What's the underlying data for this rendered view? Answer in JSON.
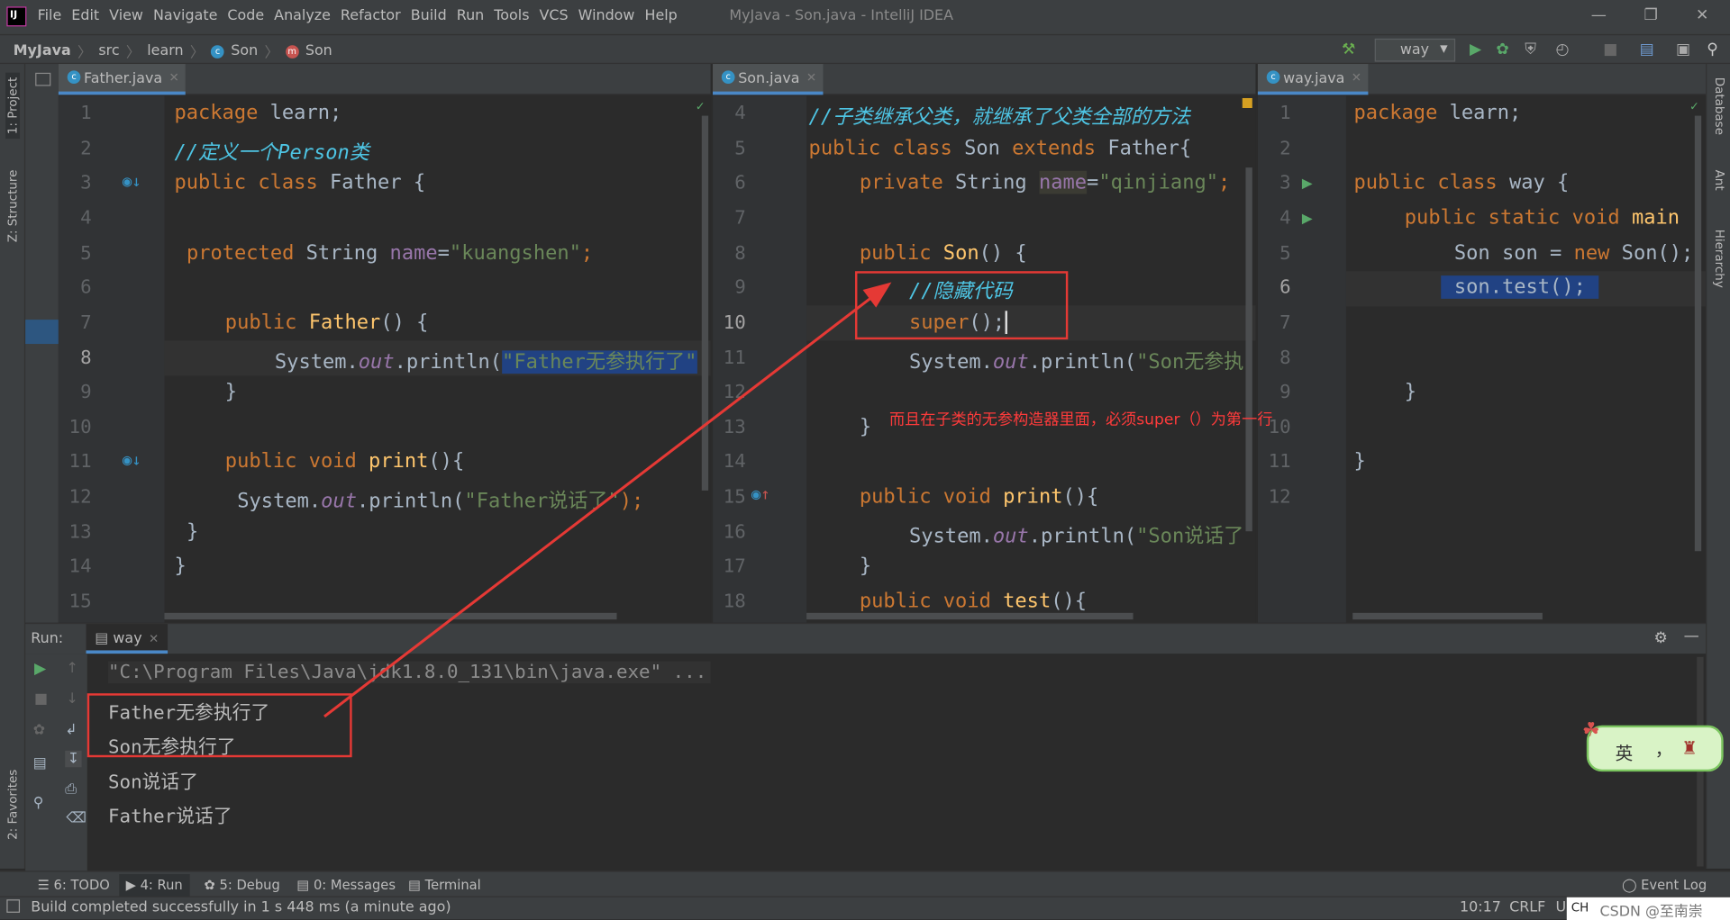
{
  "menubar": {
    "items": [
      "File",
      "Edit",
      "View",
      "Navigate",
      "Code",
      "Analyze",
      "Refactor",
      "Build",
      "Run",
      "Tools",
      "VCS",
      "Window",
      "Help"
    ],
    "title": "MyJava - Son.java - IntelliJ IDEA"
  },
  "nav": {
    "project": "MyJava",
    "src": "src",
    "pkg": "learn",
    "cls": "Son",
    "method": "Son",
    "run_config": "way"
  },
  "left_tools": {
    "project": "1: Project",
    "structure": "Z: Structure",
    "favorites": "2: Favorites"
  },
  "right_tools": {
    "database": "Database",
    "ant": "Ant",
    "hierarchy": "Hierarchy"
  },
  "editors": [
    {
      "tab": "Father.java",
      "lines": [
        "1",
        "2",
        "3",
        "4",
        "5",
        "6",
        "7",
        "8",
        "9",
        "10",
        "11",
        "12",
        "13",
        "14",
        "15"
      ]
    },
    {
      "tab": "Son.java",
      "lines": [
        "4",
        "5",
        "6",
        "7",
        "8",
        "9",
        "10",
        "11",
        "12",
        "13",
        "14",
        "15",
        "16",
        "17",
        "18"
      ]
    },
    {
      "tab": "way.java",
      "lines": [
        "1",
        "2",
        "3",
        "4",
        "5",
        "6",
        "7",
        "8",
        "9",
        "10",
        "11",
        "12"
      ]
    }
  ],
  "father_code": {
    "l1a": "package",
    "l1b": " learn;",
    "l2": "//定义一个Person类",
    "l3a": "public class",
    "l3b": " Father {",
    "l5a": "protected",
    "l5b": " String ",
    "l5c": "name",
    "l5d": "=",
    "l5e": "\"kuangshen\"",
    "l5f": ";",
    "l7a": "public",
    "l7b": " ",
    "l7c": "Father",
    "l7d": "() {",
    "l8a": "System.",
    "l8b": "out",
    "l8c": ".println(",
    "l8d": "\"Father无参执行了\"",
    "l9": "}",
    "l11a": "public void",
    "l11b": " ",
    "l11c": "print",
    "l11d": "(){",
    "l12a": "System.",
    "l12b": "out",
    "l12c": ".println(",
    "l12d": "\"Father说话了\"",
    "l12e": ");",
    "l13": "}",
    "l14": "}"
  },
  "son_code": {
    "l4": "//子类继承父类，就继承了父类全部的方法",
    "l5a": "public class",
    "l5b": " Son ",
    "l5c": "extends",
    "l5d": " Father{",
    "l6a": "private",
    "l6b": " String ",
    "l6c": "name",
    "l6d": "=",
    "l6e": "\"qinjiang\"",
    "l6f": ";",
    "l8a": "public",
    "l8b": " ",
    "l8c": "Son",
    "l8d": "() {",
    "l9": "//隐藏代码",
    "l10a": "super",
    "l10b": "();",
    "l11a": "System.",
    "l11b": "out",
    "l11c": ".println(",
    "l11d": "\"Son无参执",
    "l13": "}",
    "l15a": "public void",
    "l15b": " ",
    "l15c": "print",
    "l15d": "(){",
    "l16a": "System.",
    "l16b": "out",
    "l16c": ".println(",
    "l16d": "\"Son说话了",
    "l17": "}",
    "l18a": "public void",
    "l18b": " ",
    "l18c": "test",
    "l18d": "(){"
  },
  "way_code": {
    "l1a": "package",
    "l1b": " learn;",
    "l3a": "public class",
    "l3b": " way {",
    "l4a": "public static void",
    "l4b": " ",
    "l4c": "main",
    "l5a": "Son son = ",
    "l5b": "new",
    "l5c": " Son();",
    "l6": "son.test();",
    "l9": "}",
    "l11": "}"
  },
  "annotation": "而且在子类的无参构造器里面，必须super（）为第一行",
  "run": {
    "label": "Run:",
    "tab": "way",
    "cmd": "\"C:\\Program Files\\Java\\jdk1.8.0_131\\bin\\java.exe\" ...",
    "output": [
      "Father无参执行了",
      "Son无参执行了",
      "Son说话了",
      "Father说话了"
    ]
  },
  "bottom_tabs": {
    "todo": "6: TODO",
    "run": "4: Run",
    "debug": "5: Debug",
    "messages": "0: Messages",
    "terminal": "Terminal",
    "eventlog": "Event Log"
  },
  "status": {
    "msg": "Build completed successfully in 1 s 448 ms (a minute ago)",
    "pos": "10:17",
    "crlf": "CRLF",
    "enc": "U"
  },
  "ime": {
    "lang": "英",
    "punct": "，"
  },
  "watermark": "CSDN @至南崇",
  "ime2": "CH"
}
